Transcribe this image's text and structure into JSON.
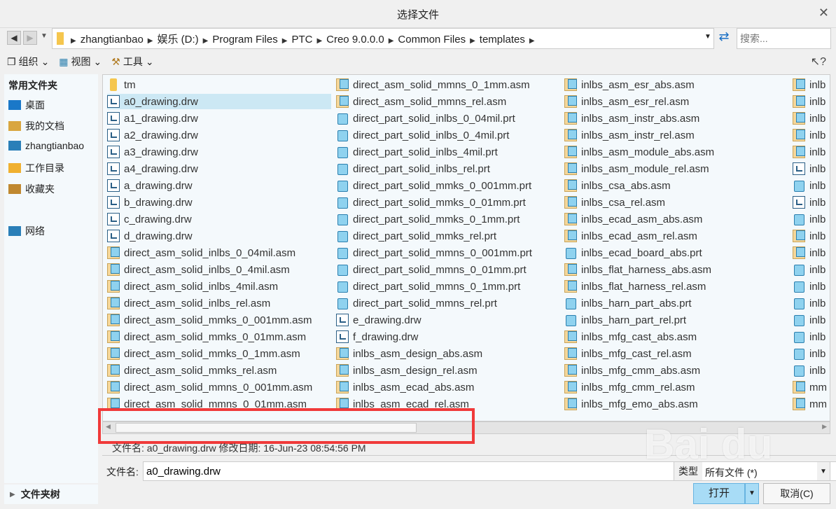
{
  "window": {
    "title": "选择文件"
  },
  "nav": {
    "crumbs": [
      "zhangtianbao",
      "娱乐 (D:)",
      "Program Files",
      "PTC",
      "Creo 9.0.0.0",
      "Common Files",
      "templates"
    ],
    "search_placeholder": "搜索..."
  },
  "toolbar": {
    "organize": "组织",
    "view": "视图",
    "tools": "工具"
  },
  "sidebar": {
    "header": "常用文件夹",
    "items": [
      {
        "label": "桌面",
        "icon": "desktop-icon"
      },
      {
        "label": "我的文档",
        "icon": "documents-icon"
      },
      {
        "label": "zhangtianbao",
        "icon": "computer-icon"
      },
      {
        "label": "工作目录",
        "icon": "working-dir-icon"
      },
      {
        "label": "收藏夹",
        "icon": "favorites-icon"
      },
      {
        "label": "网络",
        "icon": "network-icon"
      }
    ],
    "folder_tree": "文件夹树"
  },
  "files": {
    "selected": "a0_drawing.drw",
    "columns": [
      [
        {
          "n": "tm",
          "t": "folder"
        },
        {
          "n": "a0_drawing.drw",
          "t": "drw"
        },
        {
          "n": "a1_drawing.drw",
          "t": "drw"
        },
        {
          "n": "a2_drawing.drw",
          "t": "drw"
        },
        {
          "n": "a3_drawing.drw",
          "t": "drw"
        },
        {
          "n": "a4_drawing.drw",
          "t": "drw"
        },
        {
          "n": "a_drawing.drw",
          "t": "drw"
        },
        {
          "n": "b_drawing.drw",
          "t": "drw"
        },
        {
          "n": "c_drawing.drw",
          "t": "drw"
        },
        {
          "n": "d_drawing.drw",
          "t": "drw"
        },
        {
          "n": "direct_asm_solid_inlbs_0_04mil.asm",
          "t": "asm"
        },
        {
          "n": "direct_asm_solid_inlbs_0_4mil.asm",
          "t": "asm"
        },
        {
          "n": "direct_asm_solid_inlbs_4mil.asm",
          "t": "asm"
        },
        {
          "n": "direct_asm_solid_inlbs_rel.asm",
          "t": "asm"
        },
        {
          "n": "direct_asm_solid_mmks_0_001mm.asm",
          "t": "asm"
        },
        {
          "n": "direct_asm_solid_mmks_0_01mm.asm",
          "t": "asm"
        },
        {
          "n": "direct_asm_solid_mmks_0_1mm.asm",
          "t": "asm"
        },
        {
          "n": "direct_asm_solid_mmks_rel.asm",
          "t": "asm"
        },
        {
          "n": "direct_asm_solid_mmns_0_001mm.asm",
          "t": "asm"
        },
        {
          "n": "direct_asm_solid_mmns_0_01mm.asm",
          "t": "asm"
        }
      ],
      [
        {
          "n": "direct_asm_solid_mmns_0_1mm.asm",
          "t": "asm"
        },
        {
          "n": "direct_asm_solid_mmns_rel.asm",
          "t": "asm"
        },
        {
          "n": "direct_part_solid_inlbs_0_04mil.prt",
          "t": "prt"
        },
        {
          "n": "direct_part_solid_inlbs_0_4mil.prt",
          "t": "prt"
        },
        {
          "n": "direct_part_solid_inlbs_4mil.prt",
          "t": "prt"
        },
        {
          "n": "direct_part_solid_inlbs_rel.prt",
          "t": "prt"
        },
        {
          "n": "direct_part_solid_mmks_0_001mm.prt",
          "t": "prt"
        },
        {
          "n": "direct_part_solid_mmks_0_01mm.prt",
          "t": "prt"
        },
        {
          "n": "direct_part_solid_mmks_0_1mm.prt",
          "t": "prt"
        },
        {
          "n": "direct_part_solid_mmks_rel.prt",
          "t": "prt"
        },
        {
          "n": "direct_part_solid_mmns_0_001mm.prt",
          "t": "prt"
        },
        {
          "n": "direct_part_solid_mmns_0_01mm.prt",
          "t": "prt"
        },
        {
          "n": "direct_part_solid_mmns_0_1mm.prt",
          "t": "prt"
        },
        {
          "n": "direct_part_solid_mmns_rel.prt",
          "t": "prt"
        },
        {
          "n": "e_drawing.drw",
          "t": "drw"
        },
        {
          "n": "f_drawing.drw",
          "t": "drw"
        },
        {
          "n": "inlbs_asm_design_abs.asm",
          "t": "asm"
        },
        {
          "n": "inlbs_asm_design_rel.asm",
          "t": "asm"
        },
        {
          "n": "inlbs_asm_ecad_abs.asm",
          "t": "asm"
        },
        {
          "n": "inlbs_asm_ecad_rel.asm",
          "t": "asm"
        }
      ],
      [
        {
          "n": "inlbs_asm_esr_abs.asm",
          "t": "asm"
        },
        {
          "n": "inlbs_asm_esr_rel.asm",
          "t": "asm"
        },
        {
          "n": "inlbs_asm_instr_abs.asm",
          "t": "asm"
        },
        {
          "n": "inlbs_asm_instr_rel.asm",
          "t": "asm"
        },
        {
          "n": "inlbs_asm_module_abs.asm",
          "t": "asm"
        },
        {
          "n": "inlbs_asm_module_rel.asm",
          "t": "asm"
        },
        {
          "n": "inlbs_csa_abs.asm",
          "t": "asm"
        },
        {
          "n": "inlbs_csa_rel.asm",
          "t": "asm"
        },
        {
          "n": "inlbs_ecad_asm_abs.asm",
          "t": "asm"
        },
        {
          "n": "inlbs_ecad_asm_rel.asm",
          "t": "asm"
        },
        {
          "n": "inlbs_ecad_board_abs.prt",
          "t": "prt"
        },
        {
          "n": "inlbs_flat_harness_abs.asm",
          "t": "asm"
        },
        {
          "n": "inlbs_flat_harness_rel.asm",
          "t": "asm"
        },
        {
          "n": "inlbs_harn_part_abs.prt",
          "t": "prt"
        },
        {
          "n": "inlbs_harn_part_rel.prt",
          "t": "prt"
        },
        {
          "n": "inlbs_mfg_cast_abs.asm",
          "t": "asm"
        },
        {
          "n": "inlbs_mfg_cast_rel.asm",
          "t": "asm"
        },
        {
          "n": "inlbs_mfg_cmm_abs.asm",
          "t": "asm"
        },
        {
          "n": "inlbs_mfg_cmm_rel.asm",
          "t": "asm"
        },
        {
          "n": "inlbs_mfg_emo_abs.asm",
          "t": "asm"
        }
      ],
      [
        {
          "n": "inlb",
          "t": "asm"
        },
        {
          "n": "inlb",
          "t": "asm"
        },
        {
          "n": "inlb",
          "t": "asm"
        },
        {
          "n": "inlb",
          "t": "asm"
        },
        {
          "n": "inlb",
          "t": "asm"
        },
        {
          "n": "inlb",
          "t": "drw"
        },
        {
          "n": "inlb",
          "t": "prt"
        },
        {
          "n": "inlb",
          "t": "drw"
        },
        {
          "n": "inlb",
          "t": "prt"
        },
        {
          "n": "inlb",
          "t": "asm"
        },
        {
          "n": "inlb",
          "t": "asm"
        },
        {
          "n": "inlb",
          "t": "prt"
        },
        {
          "n": "inlb",
          "t": "prt"
        },
        {
          "n": "inlb",
          "t": "prt"
        },
        {
          "n": "inlb",
          "t": "prt"
        },
        {
          "n": "inlb",
          "t": "prt"
        },
        {
          "n": "inlb",
          "t": "prt"
        },
        {
          "n": "inlb",
          "t": "prt"
        },
        {
          "n": "mm",
          "t": "asm"
        },
        {
          "n": "mm",
          "t": "asm"
        }
      ]
    ]
  },
  "status": {
    "text": "文件名: a0_drawing.drw  修改日期: 16-Jun-23 08:54:56 PM"
  },
  "bottom": {
    "filename_label": "文件名:",
    "filename_value": "a0_drawing.drw",
    "type_label": "类型",
    "type_value": "所有文件 (*)",
    "open": "打开",
    "cancel": "取消(C)"
  },
  "colors": {
    "selection": "#cce8f4",
    "open_button": "#a8dcf6",
    "highlight_box": "#f03a3a"
  },
  "watermark": "Baidu 经验 jingyan.baidu.com"
}
